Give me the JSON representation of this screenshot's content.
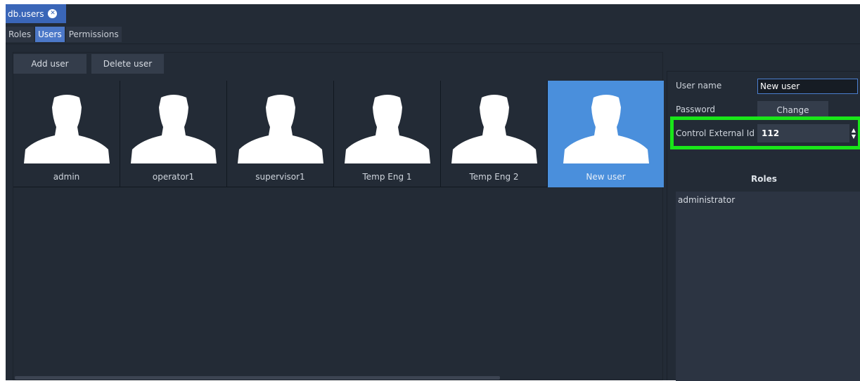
{
  "window": {
    "tab_title": "db.users",
    "close_glyph": "✕"
  },
  "subtabs": [
    {
      "label": "Roles",
      "active": false
    },
    {
      "label": "Users",
      "active": true
    },
    {
      "label": "Permissions",
      "active": false
    }
  ],
  "toolbar": {
    "add_label": "Add user",
    "delete_label": "Delete user"
  },
  "users": [
    {
      "name": "admin",
      "selected": false
    },
    {
      "name": "operator1",
      "selected": false
    },
    {
      "name": "supervisor1",
      "selected": false
    },
    {
      "name": "Temp Eng 1",
      "selected": false
    },
    {
      "name": "Temp Eng 2",
      "selected": false
    },
    {
      "name": "New user",
      "selected": true
    }
  ],
  "details": {
    "username_label": "User name",
    "username_value": "New user",
    "password_label": "Password",
    "change_label": "Change",
    "external_id_label": "Control External Id",
    "external_id_value": "112",
    "spinner_up": "▲",
    "spinner_down": "▼",
    "roles_heading": "Roles",
    "roles": [
      "administrator"
    ]
  },
  "colors": {
    "background": "#232b36",
    "accent": "#4c78c8",
    "selected_tile": "#4a8fdc",
    "highlight": "#19e619"
  },
  "icons": {
    "user_avatar": "user-silhouette-icon",
    "close": "close-icon"
  }
}
